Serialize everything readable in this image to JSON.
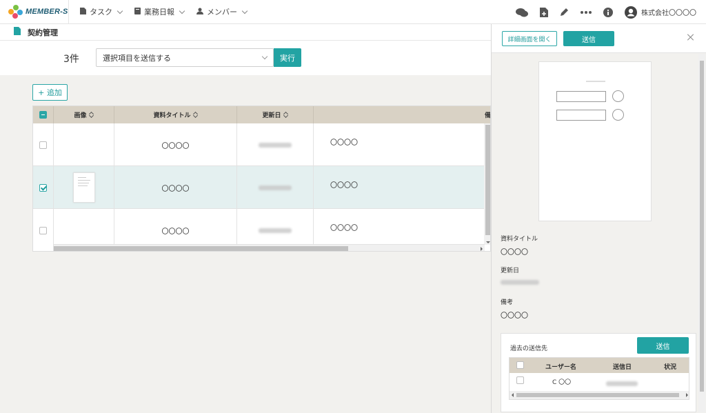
{
  "brand": {
    "logo_text": "MEMBER-S",
    "colors": {
      "accent": "#22a3a3",
      "header_bg": "#d9d2c5",
      "selected_row": "#e4f0f0"
    }
  },
  "nav": {
    "items": [
      {
        "label": "タスク",
        "icon": "document-icon"
      },
      {
        "label": "業務日報",
        "icon": "book-icon"
      },
      {
        "label": "メンバー",
        "icon": "person-icon"
      }
    ],
    "right_icons": [
      "chat-icon",
      "file-add-icon",
      "pencil-icon",
      "more-icon",
      "info-icon",
      "account-icon"
    ],
    "company": "株式会社〇〇〇〇"
  },
  "breadcrumb": {
    "title": "契約管理"
  },
  "toolbar": {
    "count": "3件",
    "select_value": "選択項目を送信する",
    "run_label": "実行",
    "add_label": "+ 追加"
  },
  "table": {
    "columns": [
      "画像",
      "資料タイトル",
      "更新日",
      "備考"
    ],
    "rows": [
      {
        "checked": false,
        "has_image": false,
        "title": "〇〇〇〇",
        "note": "〇〇〇〇"
      },
      {
        "checked": true,
        "has_image": true,
        "title": "〇〇〇〇",
        "note": "〇〇〇〇"
      },
      {
        "checked": false,
        "has_image": false,
        "title": "〇〇〇〇",
        "note": "〇〇〇〇"
      }
    ]
  },
  "panel": {
    "detail_label": "詳細画面を開く",
    "send_label": "送信",
    "fields": [
      {
        "label": "資料タイトル",
        "value": "〇〇〇〇"
      },
      {
        "label": "更新日",
        "value": ""
      },
      {
        "label": "備考",
        "value": "〇〇〇〇"
      }
    ],
    "history": {
      "title": "過去の送信先",
      "send_label": "送信",
      "columns": [
        "ユーザー名",
        "送信日",
        "状況"
      ],
      "rows": [
        {
          "user": "C 〇〇",
          "status": ""
        }
      ]
    }
  }
}
